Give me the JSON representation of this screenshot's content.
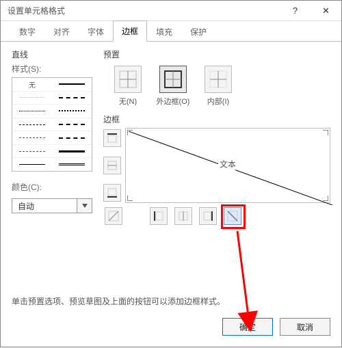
{
  "title": "设置单元格格式",
  "titlebar": {
    "help": "?",
    "close": "✕"
  },
  "tabs": [
    {
      "label": "数字"
    },
    {
      "label": "对齐"
    },
    {
      "label": "字体"
    },
    {
      "label": "边框",
      "active": true
    },
    {
      "label": "填充"
    },
    {
      "label": "保护"
    }
  ],
  "line": {
    "section": "直线",
    "style_label": "样式(S):",
    "none_label": "无"
  },
  "color": {
    "label": "颜色(C):",
    "value": "自动"
  },
  "preset": {
    "section": "预置",
    "items": [
      {
        "label": "无(N)"
      },
      {
        "label": "外边框(O)"
      },
      {
        "label": "内部(I)"
      }
    ]
  },
  "border": {
    "section": "边框",
    "preview_text": "文本"
  },
  "hint": "单击预置选项、预览草图及上面的按钮可以添加边框样式。",
  "footer": {
    "ok": "确定",
    "cancel": "取消"
  }
}
